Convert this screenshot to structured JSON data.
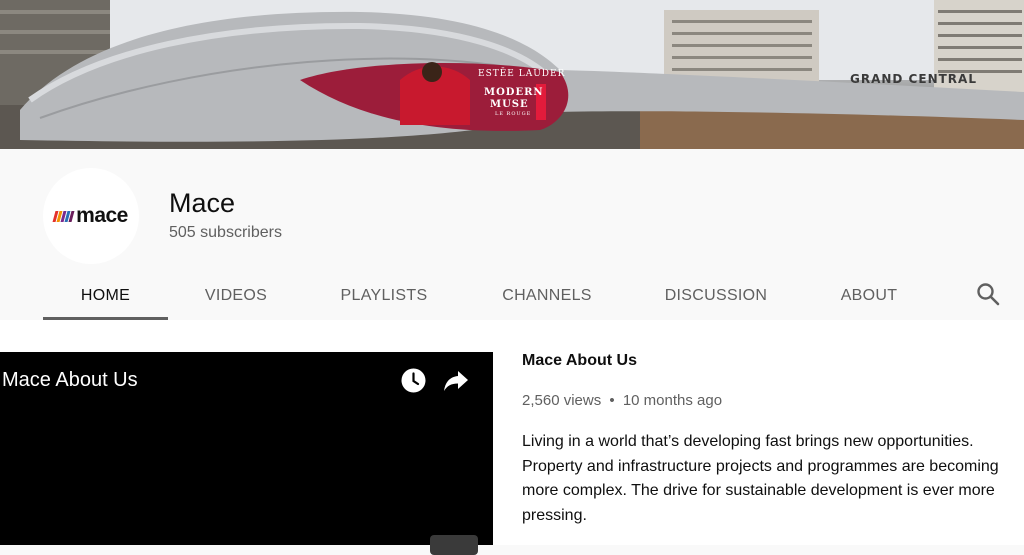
{
  "banner": {
    "billboard_brand": "ESTĒE LAUDER",
    "billboard_line1": "MODERN",
    "billboard_line2": "MUSE",
    "billboard_line3": "LE ROUGE",
    "building_sign": "GRAND CENTRAL"
  },
  "channel": {
    "avatar_logo_text": "mace",
    "avatar_bar_colors": [
      "#e4312b",
      "#f39200",
      "#7a2a8c",
      "#2a6fb6",
      "#6b1f5c"
    ],
    "name": "Mace",
    "subscribers": "505 subscribers"
  },
  "tabs": [
    {
      "label": "HOME",
      "active": true
    },
    {
      "label": "VIDEOS",
      "active": false
    },
    {
      "label": "PLAYLISTS",
      "active": false
    },
    {
      "label": "CHANNELS",
      "active": false
    },
    {
      "label": "DISCUSSION",
      "active": false
    },
    {
      "label": "ABOUT",
      "active": false
    }
  ],
  "search": {
    "icon": "search-icon"
  },
  "featured_video": {
    "player_title": "Mace About Us",
    "watch_later_icon": "clock-icon",
    "share_icon": "share-arrow-icon",
    "title": "Mace About Us",
    "views": "2,560 views",
    "separator": "•",
    "age": "10 months ago",
    "description": "Living in a world that’s developing fast brings new opportunities. Property and infrastructure projects and programmes are becoming more complex. The drive for sustainable development is ever more pressing."
  },
  "colors": {
    "page_bg": "#f9f9f9",
    "text_primary": "#0f0f0f",
    "text_secondary": "#606060"
  }
}
